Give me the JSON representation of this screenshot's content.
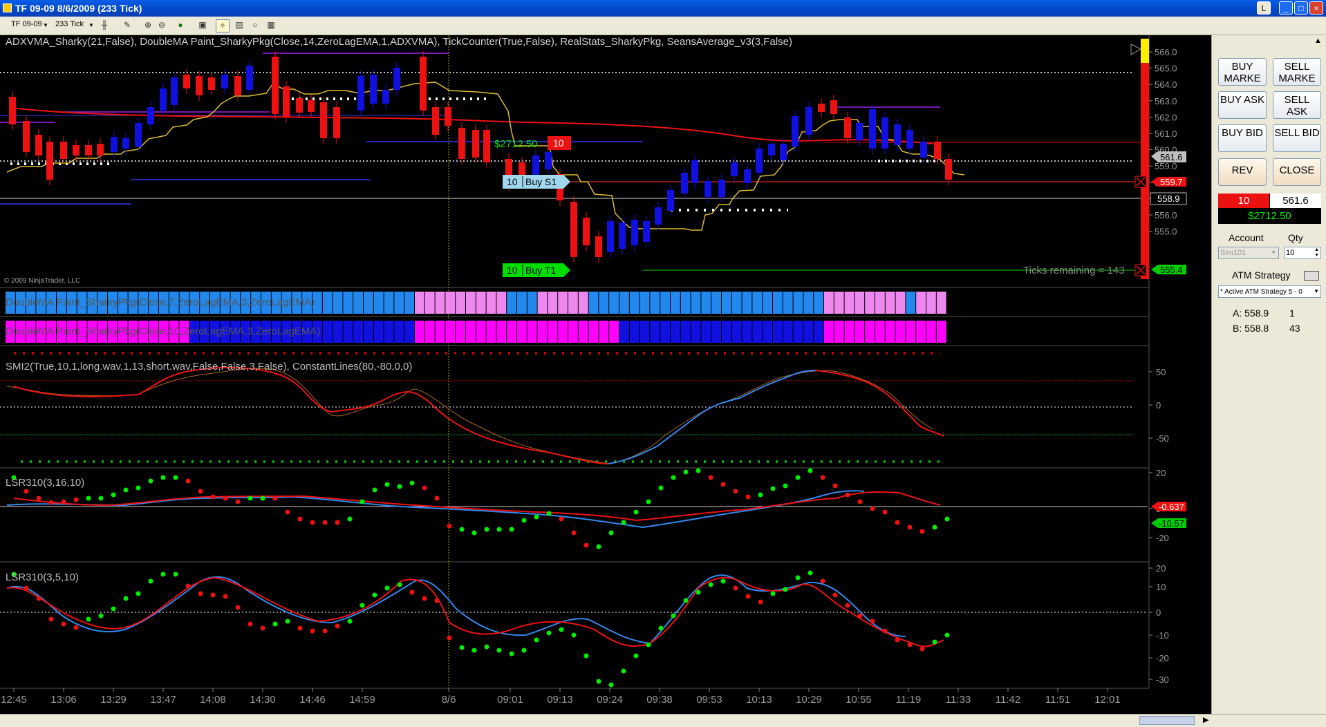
{
  "window": {
    "title": "TF 09-09  8/6/2009 (233 Tick)",
    "btn_l": "L",
    "btn_min": "_",
    "btn_max": "□",
    "btn_close": "×"
  },
  "toolbar": {
    "instrument": "TF 09-09",
    "interval": "233 Tick"
  },
  "chart": {
    "indicator_label": "ADXVMA_Sharky(21,False),  DoubleMA  Paint_SharkyPkg(Close,14,ZeroLagEMA,1,ADXVMA),  TickCounter(True,False),  RealStats_SharkyPkg,  SeansAverage_v3(3,False)",
    "copyright": "© 2009 NinjaTrader, LLC",
    "ticks_remaining": "Ticks remaining = 143",
    "price_ticks": [
      "566.0",
      "565.0",
      "564.0",
      "563.0",
      "562.0",
      "561.0",
      "560.0",
      "559.0",
      "558.0",
      "557.0",
      "556.0",
      "555.0"
    ],
    "tags": {
      "current": "561.6",
      "stop": "559.7",
      "last": "558.9",
      "target": "555.4",
      "pnl": "$2712.50",
      "qty_tag": "10",
      "buy_s1_qty": "10",
      "buy_s1": "Buy S1",
      "buy_t1_qty": "10",
      "buy_t1": "Buy T1"
    },
    "panel2_label": "DoubleMA  Paint_SharkyPkg(Close,7,ZeroLagEMA,3,ZeroLagEMA)",
    "panel3_label": "DoubleMA  Paint_SharkyPkg(Close,10,ZeroLagEMA,3,ZeroLagEMA)",
    "smi_label": "SMI2(True,10,1,long.wav,1,13,short.wav,False,False,3,False),  ConstantLines(80,-80,0,0)",
    "smi_ticks": [
      "50",
      "0",
      "-50"
    ],
    "lsr1_label": "LSR310(3,16,10)",
    "lsr1_ticks": [
      "20",
      "0",
      "-20"
    ],
    "lsr1_tags": {
      "red": "-0.637",
      "green": "-10.57"
    },
    "lsr2_label": "LSR310(3,5,10)",
    "lsr2_ticks": [
      "20",
      "10",
      "0",
      "-10",
      "-20",
      "-30"
    ],
    "time_labels": [
      "12:45",
      "13:06",
      "13:29",
      "13:47",
      "14:08",
      "14:30",
      "14:46",
      "14:59",
      "8/6",
      "09:01",
      "09:13",
      "09:24",
      "09:38",
      "09:53",
      "10:13",
      "10:29",
      "10:55",
      "11:19",
      "11:33",
      "11:42",
      "11:51",
      "12:01"
    ]
  },
  "panel": {
    "buy_market": "BUY MARKE",
    "sell_market": "SELL MARKE",
    "buy_ask": "BUY ASK",
    "sell_ask": "SELL ASK",
    "buy_bid": "BUY BID",
    "sell_bid": "SELL BID",
    "rev": "REV",
    "close": "CLOSE",
    "pos_qty": "10",
    "pos_price": "561.6",
    "pos_pnl": "$2712.50",
    "account_label": "Account",
    "qty_label": "Qty",
    "account_value": "Sim101",
    "qty_value": "10",
    "atm_label": "ATM Strategy",
    "atm_value": "* Active ATM Strategy 5 - 0",
    "ask_label": "A: 558.9",
    "ask_size": "1",
    "bid_label": "B: 558.8",
    "bid_size": "43"
  },
  "colors": {
    "up": "#1010e0",
    "down": "#ee1111",
    "pink": "#ee88ee",
    "magenta": "#ff00ff",
    "lightblue": "#2288ee",
    "green": "#00cc00"
  }
}
